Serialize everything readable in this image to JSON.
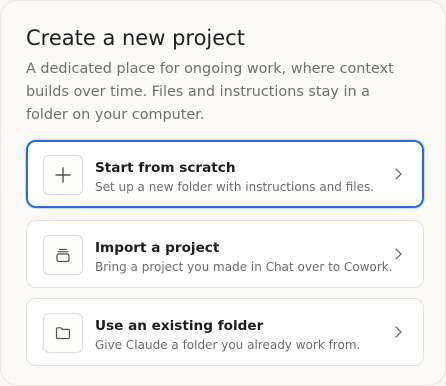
{
  "dialog": {
    "title": "Create a new project",
    "description": "A dedicated place for ongoing work, where context builds over time. Files and instructions stay in a folder on your computer."
  },
  "options": [
    {
      "title": "Start from scratch",
      "subtitle": "Set up a new folder with instructions and files.",
      "icon": "plus-icon",
      "selected": true
    },
    {
      "title": "Import a project",
      "subtitle": "Bring a project you made in Chat over to Cowork.",
      "icon": "archive-box-icon",
      "selected": false
    },
    {
      "title": "Use an existing folder",
      "subtitle": "Give Claude a folder you already work from.",
      "icon": "folder-icon",
      "selected": false
    }
  ],
  "colors": {
    "selected_border": "#2e6cd0",
    "text_primary": "#1f1e1c",
    "text_secondary": "#716f6a"
  }
}
